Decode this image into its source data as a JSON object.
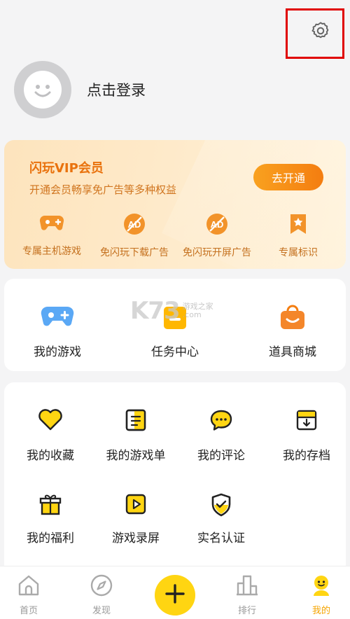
{
  "header": {
    "settings_icon": "gear-icon",
    "login_text": "点击登录",
    "avatar_icon": "smiley-avatar-icon"
  },
  "vip": {
    "title": "闪玩VIP会员",
    "subtitle": "开通会员畅享免广告等多种权益",
    "button": "去开通",
    "perks": [
      {
        "label": "专属主机游戏",
        "icon": "gamepad-icon"
      },
      {
        "label": "免闪玩下载广告",
        "icon": "no-ad-icon"
      },
      {
        "label": "免闪玩开屏广告",
        "icon": "no-ad-icon"
      },
      {
        "label": "专属标识",
        "icon": "bookmark-star-icon"
      }
    ]
  },
  "shortcuts": [
    {
      "label": "我的游戏",
      "icon": "gamepad-icon"
    },
    {
      "label": "任务中心",
      "icon": "task-icon"
    },
    {
      "label": "道具商城",
      "icon": "shopping-bag-icon"
    }
  ],
  "watermark": {
    "main": "K73",
    "line1": "游戏之家",
    "line2": ".com"
  },
  "menu": [
    {
      "label": "我的收藏",
      "icon": "heart-icon"
    },
    {
      "label": "我的游戏单",
      "icon": "list-icon"
    },
    {
      "label": "我的评论",
      "icon": "comment-icon"
    },
    {
      "label": "我的存档",
      "icon": "archive-icon"
    },
    {
      "label": "我的福利",
      "icon": "gift-icon"
    },
    {
      "label": "游戏录屏",
      "icon": "video-play-icon"
    },
    {
      "label": "实名认证",
      "icon": "shield-check-icon"
    }
  ],
  "tabbar": [
    {
      "label": "首页",
      "icon": "home-icon"
    },
    {
      "label": "发现",
      "icon": "compass-icon"
    },
    {
      "label": "",
      "icon": "plus-icon"
    },
    {
      "label": "排行",
      "icon": "ranking-icon"
    },
    {
      "label": "我的",
      "icon": "profile-icon"
    }
  ],
  "colors": {
    "accent": "#ffd512",
    "vip_orange": "#f47d10",
    "active_tab": "#f5a400",
    "highlight_box": "#e00000"
  }
}
